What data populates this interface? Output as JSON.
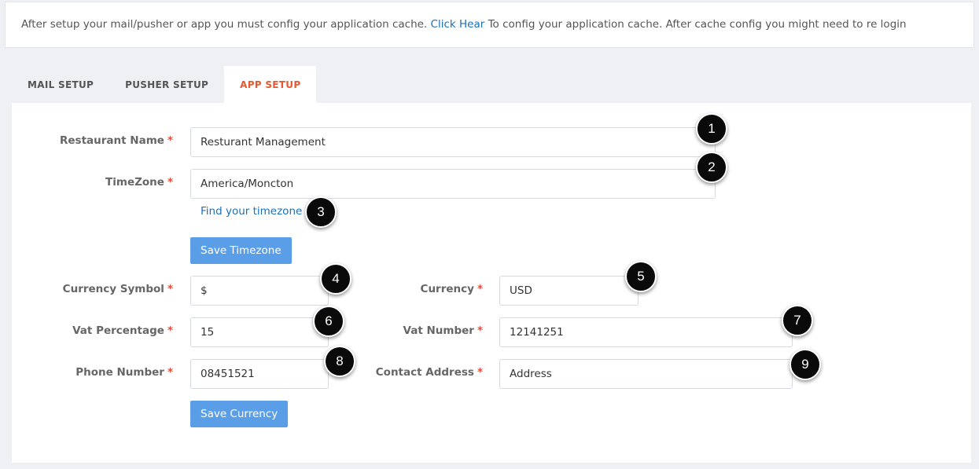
{
  "notice": {
    "text_before": "After setup your mail/pusher or app you must config your application cache.",
    "link": "Click Hear",
    "text_after": "To config your application cache. After cache config you might need to re login"
  },
  "tabs": [
    {
      "label": "MAIL SETUP",
      "active": false
    },
    {
      "label": "PUSHER SETUP",
      "active": false
    },
    {
      "label": "APP SETUP",
      "active": true
    }
  ],
  "form": {
    "required_mark": "*",
    "restaurant_name": {
      "label": "Restaurant Name",
      "value": "Resturant Management"
    },
    "timezone": {
      "label": "TimeZone",
      "value": "America/Moncton"
    },
    "find_timezone_link": "Find your timezone",
    "save_timezone_button": "Save Timezone",
    "currency_symbol": {
      "label": "Currency Symbol",
      "value": "$"
    },
    "currency": {
      "label": "Currency",
      "value": "USD"
    },
    "vat_percentage": {
      "label": "Vat Percentage",
      "value": "15"
    },
    "vat_number": {
      "label": "Vat Number",
      "value": "12141251"
    },
    "phone_number": {
      "label": "Phone Number",
      "value": "08451521"
    },
    "contact_address": {
      "label": "Contact Address",
      "value": "Address"
    },
    "save_currency_button": "Save Currency"
  },
  "markers": [
    "1",
    "2",
    "3",
    "4",
    "5",
    "6",
    "7",
    "8",
    "9"
  ]
}
